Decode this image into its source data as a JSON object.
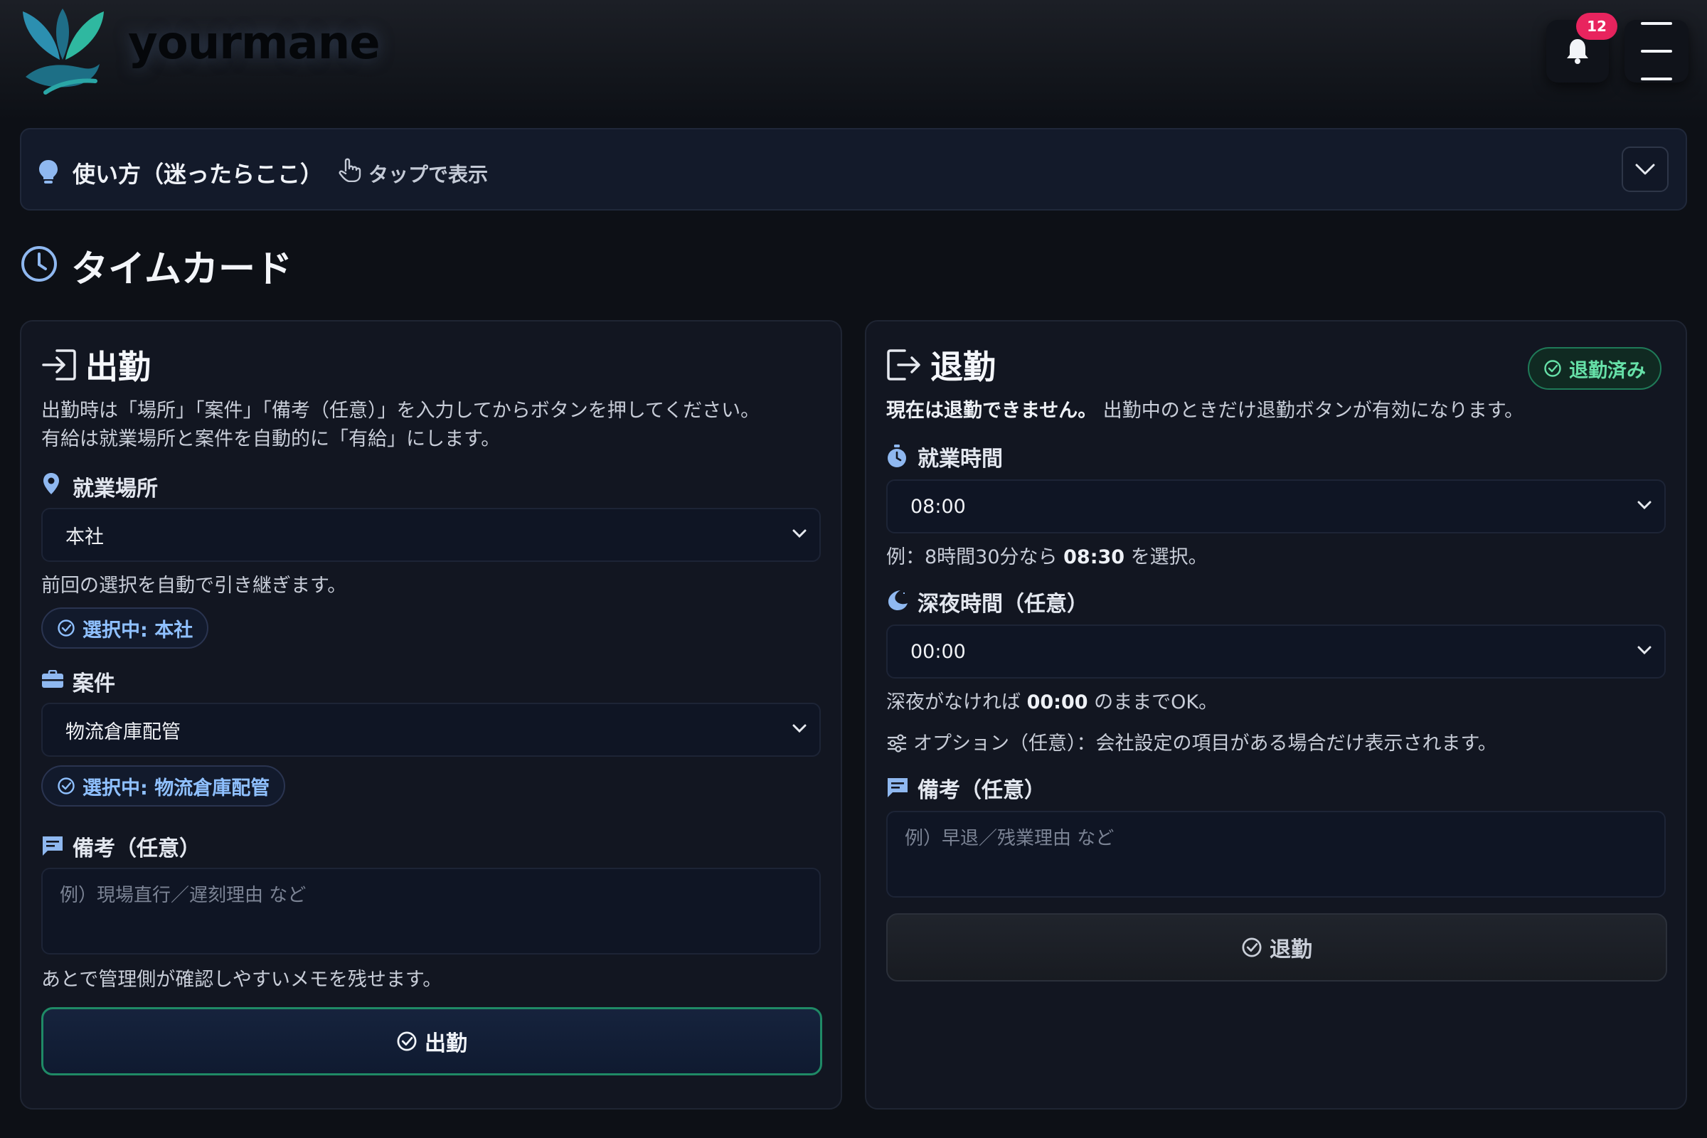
{
  "app": {
    "brand": "yourmane",
    "notification_count": "12"
  },
  "help": {
    "title": "使い方（迷ったらここ）",
    "hint": "タップで表示"
  },
  "page": {
    "title": "タイムカード"
  },
  "clock_in": {
    "title": "出勤",
    "desc_line1": "出勤時は「場所」「案件」「備考（任意）」を入力してからボタンを押してください。",
    "desc_line2": "有給は就業場所と案件を自動的に「有給」にします。",
    "location_label": "就業場所",
    "location_value": "本社",
    "location_hint": "前回の選択を自動で引き継ぎます。",
    "location_chip": "選択中: 本社",
    "project_label": "案件",
    "project_value": "物流倉庫配管",
    "project_chip": "選択中: 物流倉庫配管",
    "note_label": "備考（任意）",
    "note_placeholder": "例）現場直行／遅刻理由 など",
    "note_hint": "あとで管理側が確認しやすいメモを残せます。",
    "button_label": "出勤"
  },
  "clock_out": {
    "title": "退勤",
    "status_badge": "退勤済み",
    "desc_bold": "現在は退勤できません。",
    "desc_rest": "出勤中のときだけ退勤ボタンが有効になります。",
    "work_label": "就業時間",
    "work_value": "08:00",
    "work_hint_pre": "例：8時間30分なら",
    "work_hint_val": "08:30",
    "work_hint_post": "を選択。",
    "night_label": "深夜時間（任意）",
    "night_value": "00:00",
    "night_hint_pre": "深夜がなければ",
    "night_hint_val": "00:00",
    "night_hint_post": "のままでOK。",
    "options_text": "オプション（任意）：会社設定の項目がある場合だけ表示されます。",
    "note_label": "備考（任意）",
    "note_placeholder": "例）早退／残業理由 など",
    "button_label": "退勤"
  },
  "colors": {
    "background": "#0d1016",
    "card": "#121621",
    "accent_blue": "#8fc0ff",
    "accent_green": "#1f8a66",
    "badge_red": "#e8245e"
  },
  "icons": [
    "logo-icon",
    "bell-icon",
    "menu-icon",
    "lightbulb-icon",
    "hand-pointer-icon",
    "chevron-down-icon",
    "clock-icon",
    "login-icon",
    "logout-icon",
    "map-pin-icon",
    "briefcase-icon",
    "message-icon",
    "check-circle-icon",
    "stopwatch-icon",
    "moon-icon",
    "sliders-icon"
  ]
}
